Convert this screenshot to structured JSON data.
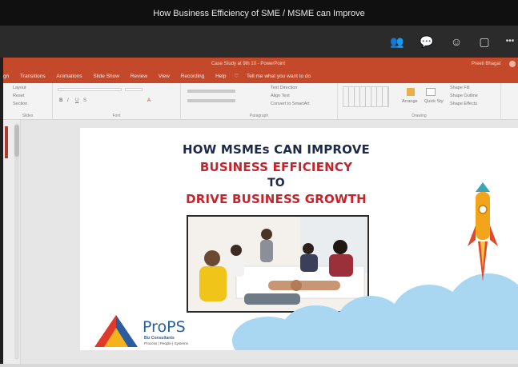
{
  "meeting": {
    "title": "How Business Efficiency of SME / MSME can Improve"
  },
  "call_controls": [
    {
      "name": "participants-icon",
      "glyph": "👥"
    },
    {
      "name": "chat-icon",
      "glyph": "💬"
    },
    {
      "name": "reactions-icon",
      "glyph": "☺"
    },
    {
      "name": "share-screen-icon",
      "glyph": "▢"
    },
    {
      "name": "more-options-icon",
      "glyph": "•••"
    }
  ],
  "powerpoint": {
    "window_title": "Case Study at 9th 10 - PowerPoint",
    "user": "Preeti Bhagat",
    "tabs": [
      "gn",
      "Transitions",
      "Animations",
      "Slide Show",
      "Review",
      "View",
      "Recording",
      "Help"
    ],
    "tell_me": "Tell me what you want to do",
    "ribbon_groups": [
      "Slides",
      "Font",
      "Paragraph",
      "Drawing"
    ],
    "ribbon_items": {
      "layout": "Layout",
      "reset": "Reset",
      "section": "Section",
      "text_direction": "Text Direction",
      "align_text": "Align Text",
      "convert_smartart": "Convert to SmartArt",
      "arrange": "Arrange",
      "quick_styles": "Quick Styles",
      "shape_fill": "Shape Fill",
      "shape_outline": "Shape Outline",
      "shape_effects": "Shape Effects"
    }
  },
  "slide": {
    "line1": "HOW MSMEs CAN IMPROVE",
    "line2": "BUSINESS EFFICIENCY",
    "line3": "TO",
    "line4": "DRIVE BUSINESS GROWTH",
    "logo_name": "ProPS",
    "logo_sub": "Biz Consultants",
    "logo_tagline": "Process | People | Systems",
    "colors": {
      "navy": "#1c2a4a",
      "red": "#c8232b",
      "cloud": "#a9d7f2",
      "rocket": "#f2a51a"
    }
  }
}
